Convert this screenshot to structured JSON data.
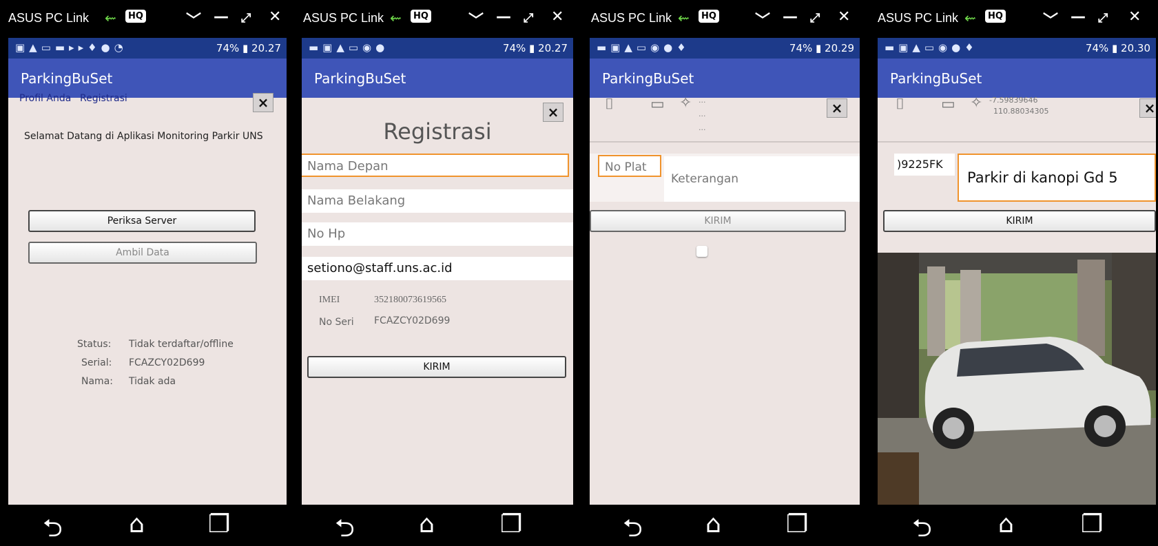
{
  "common": {
    "window_title": "ASUS PC Link",
    "hq_badge": "HQ",
    "battery": "74%",
    "app_title": "ParkingBuSet",
    "icons": [
      "usb-icon",
      "minimize-icon",
      "maximize-icon",
      "close-icon",
      "back-icon",
      "home-icon",
      "recents-icon"
    ]
  },
  "screen1": {
    "time": "20.27",
    "menu_profile": "Profil Anda",
    "menu_register": "Registrasi",
    "close": "×",
    "welcome": "Selamat Datang di Aplikasi Monitoring Parkir UNS",
    "check_server": "Periksa Server",
    "fetch_data": "Ambil Data",
    "status_label": "Status:",
    "status_value": "Tidak terdaftar/offline",
    "serial_label": "Serial:",
    "serial_value": "FCAZCY02D699",
    "name_label": "Nama:",
    "name_value": "Tidak ada"
  },
  "screen2": {
    "time": "20.27",
    "close": "×",
    "heading": "Registrasi",
    "first_name_placeholder": "Nama Depan",
    "last_name_placeholder": "Nama Belakang",
    "phone_placeholder": "No Hp",
    "email_value": "setiono@staff.uns.ac.id",
    "imei_label": "IMEI",
    "imei_value": "352180073619565",
    "serial_label": "No Seri",
    "serial_value": "FCAZCY02D699",
    "submit": "KIRIM"
  },
  "screen3": {
    "time": "20.29",
    "close": "×",
    "coords_line1": "...",
    "coords_line2": "...",
    "coords_line3": "...",
    "plate_placeholder": "No Plat",
    "note_placeholder": "Keterangan",
    "submit": "KIRIM"
  },
  "screen4": {
    "time": "20.30",
    "close": "×",
    "latitude": "-7.59839646",
    "longitude": "110.88034305",
    "plate_value": ")9225FK",
    "note_value": "Parkir di kanopi Gd 5",
    "submit": "KIRIM"
  }
}
